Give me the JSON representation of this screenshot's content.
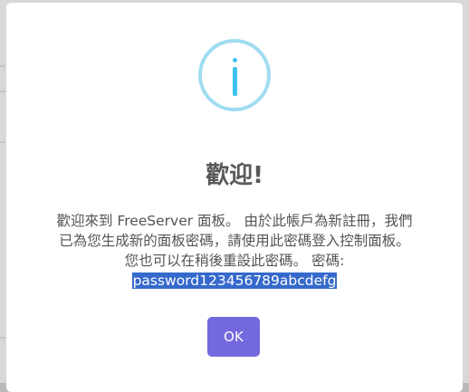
{
  "dialog": {
    "icon": "info-icon",
    "title": "歡迎!",
    "message_line1": "歡迎來到 FreeServer 面板。 由於此帳戶為新註冊，我們",
    "message_line2": "已為您生成新的面板密碼，請使用此密碼登入控制面板。",
    "message_line3": "您也可以在稍後重設此密碼。 密碼:",
    "password": "password123456789abcdefg",
    "ok_label": "OK"
  },
  "colors": {
    "icon_border": "#9fdcf1",
    "icon_glyph": "#3fc3ee",
    "button": "#7468de",
    "selection": "#3569cc"
  }
}
